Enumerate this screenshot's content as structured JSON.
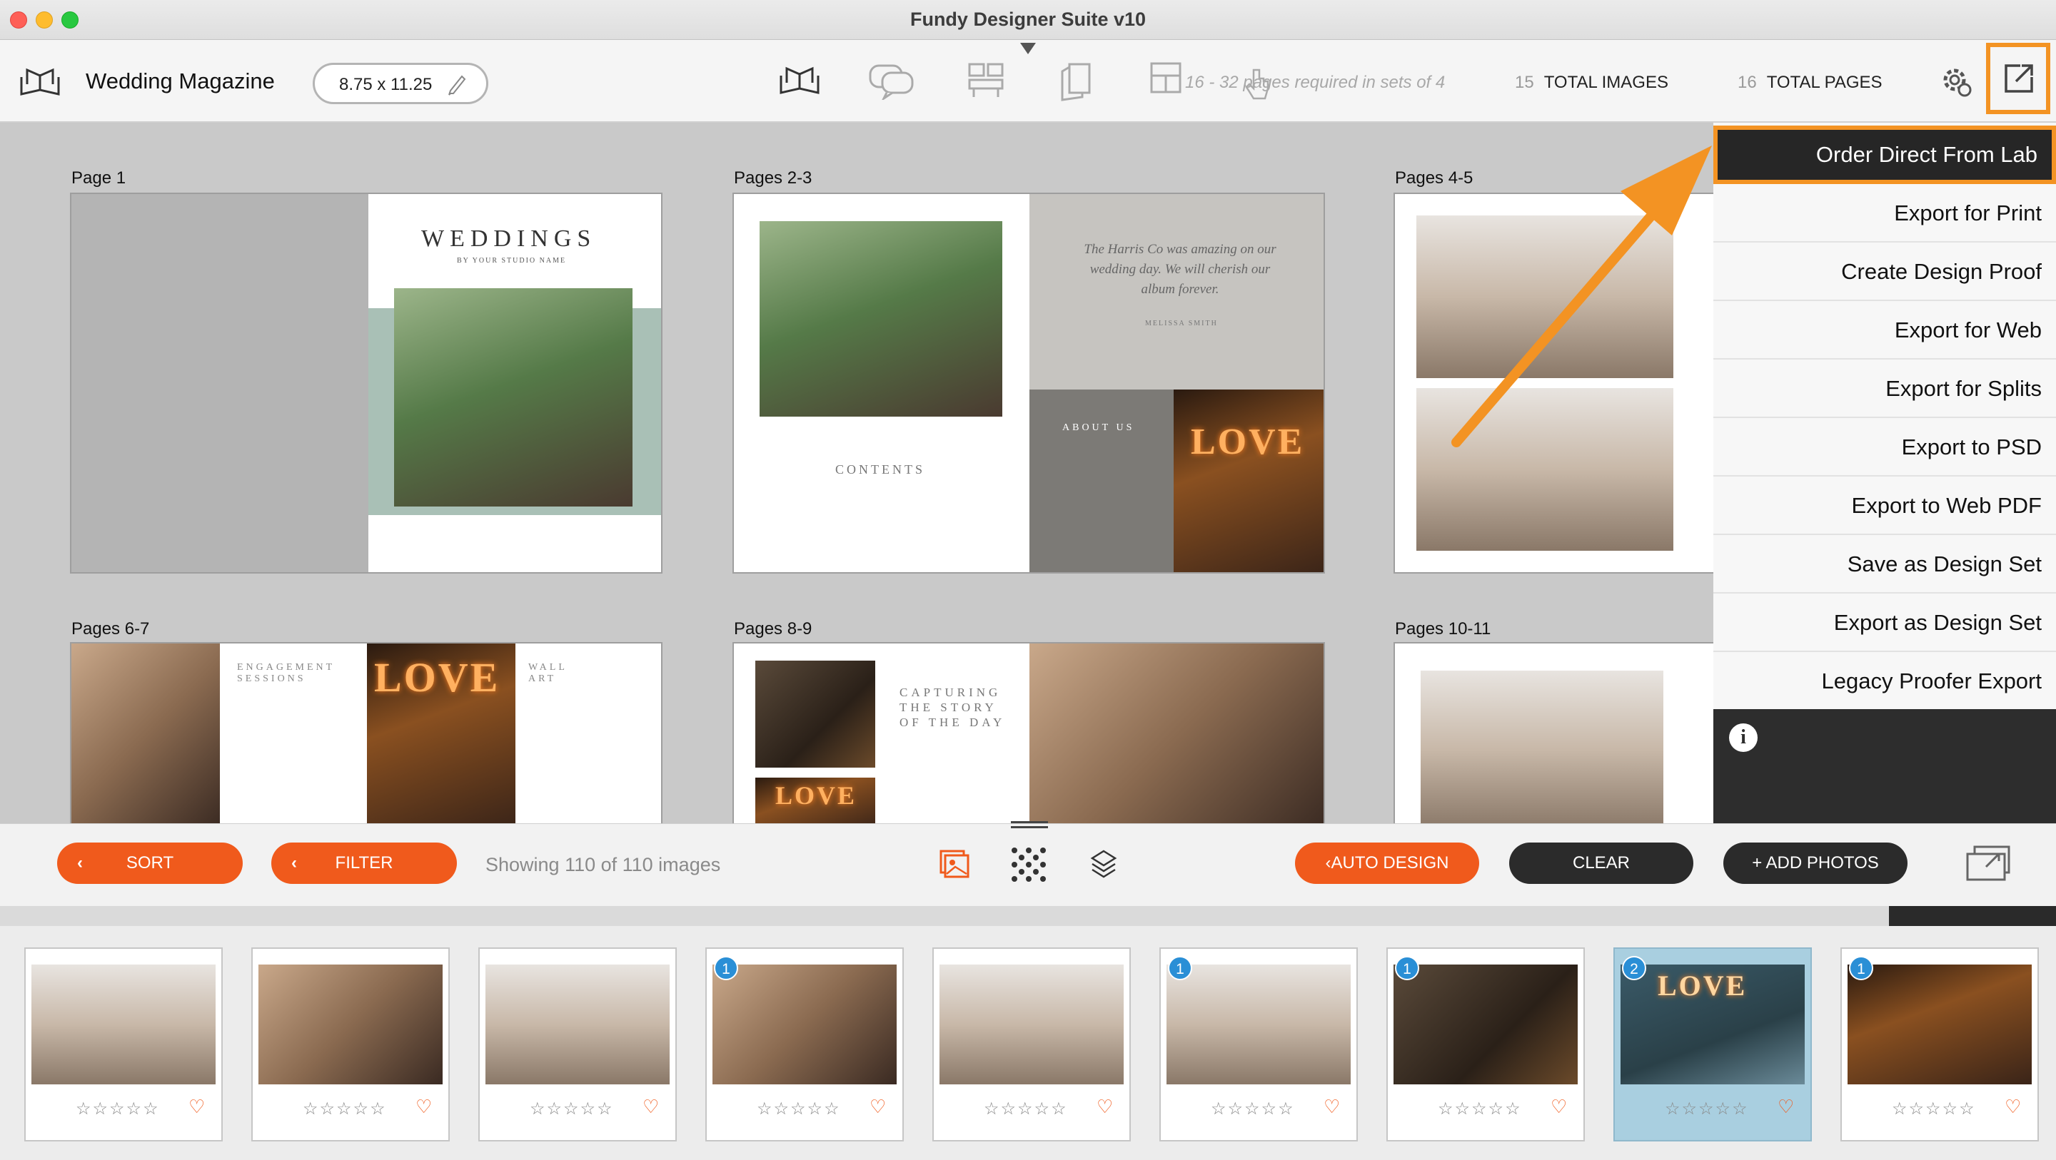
{
  "window": {
    "title": "Fundy Designer Suite v10"
  },
  "toolbar": {
    "album_name": "Wedding Magazine",
    "size": "8.75 x 11.25",
    "pages_required": "16 - 32 pages required in sets of 4",
    "total_images_count": "15",
    "total_images_label": "TOTAL IMAGES",
    "total_pages_count": "16",
    "total_pages_label": "TOTAL PAGES"
  },
  "spreads": [
    {
      "label": "Page 1"
    },
    {
      "label": "Pages 2-3"
    },
    {
      "label": "Pages 4-5"
    },
    {
      "label": "Pages 6-7"
    },
    {
      "label": "Pages 8-9"
    },
    {
      "label": "Pages 10-11"
    }
  ],
  "spread_text": {
    "weddings_title": "WEDDINGS",
    "weddings_sub": "BY YOUR STUDIO NAME",
    "quote": "The Harris Co was amazing on our wedding day. We will cherish our album forever.",
    "quote_author": "MELISSA SMITH",
    "contents": "CONTENTS",
    "about_us": "ABOUT US",
    "love": "LOVE",
    "engagement": "ENGAGEMENT SESSIONS",
    "wall_art": "WALL ART",
    "capturing": "CAPTURING THE STORY OF THE DAY"
  },
  "export_menu": {
    "items": [
      "Order Direct From Lab",
      "Export for Print",
      "Create Design Proof",
      "Export for Web",
      "Export for Splits",
      "Export to PSD",
      "Export to Web PDF",
      "Save as Design Set",
      "Export as Design Set",
      "Legacy Proofer Export"
    ]
  },
  "bottom": {
    "sort_label": "SORT",
    "filter_label": "FILTER",
    "showing": "Showing 110 of 110 images",
    "auto_design_label": "AUTO DESIGN",
    "clear_label": "CLEAR",
    "add_photos_label": "+ ADD PHOTOS"
  },
  "filmstrip": [
    {
      "badge": "",
      "stars": "☆☆☆☆☆",
      "heart": "♡"
    },
    {
      "badge": "",
      "stars": "☆☆☆☆☆",
      "heart": "♡"
    },
    {
      "badge": "",
      "stars": "☆☆☆☆☆",
      "heart": "♡"
    },
    {
      "badge": "1",
      "stars": "☆☆☆☆☆",
      "heart": "♡"
    },
    {
      "badge": "",
      "stars": "☆☆☆☆☆",
      "heart": "♡"
    },
    {
      "badge": "1",
      "stars": "☆☆☆☆☆",
      "heart": "♡"
    },
    {
      "badge": "1",
      "stars": "☆☆☆☆☆",
      "heart": "♡"
    },
    {
      "badge": "2",
      "stars": "☆☆☆☆☆",
      "heart": "♡",
      "selected": true
    },
    {
      "badge": "1",
      "stars": "☆☆☆☆☆",
      "heart": "♡"
    }
  ],
  "colors": {
    "accent": "#f39323",
    "orange_button": "#f05a1c",
    "dark_button": "#2b2b2b",
    "badge": "#2a8fd6"
  }
}
